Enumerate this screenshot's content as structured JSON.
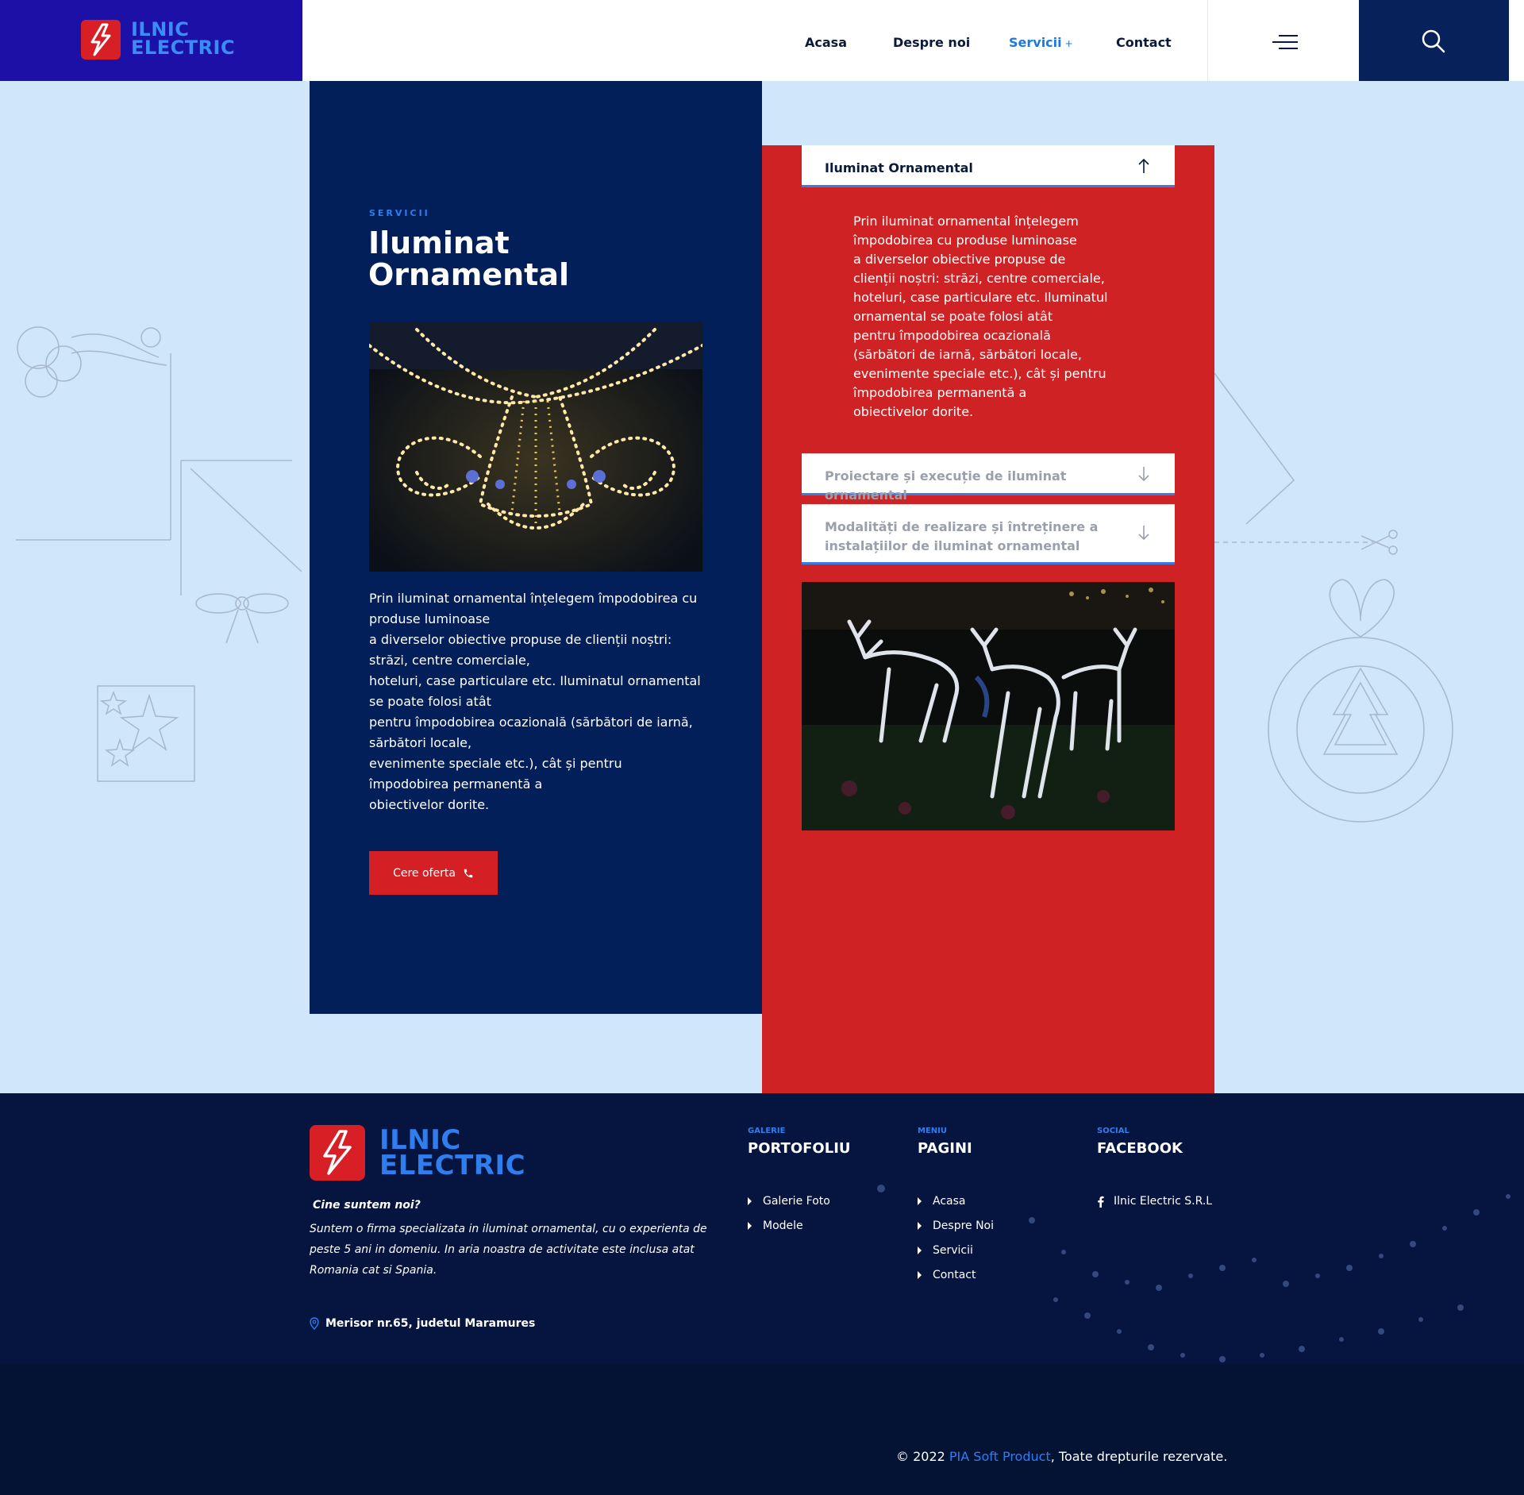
{
  "brand": {
    "line1": "ILNIC",
    "line2": "ELECTRIC"
  },
  "nav": {
    "items": [
      "Acasa",
      "Despre noi",
      "Servicii",
      "Contact"
    ],
    "active": "Servicii",
    "servicii_suffix": "+"
  },
  "colors": {
    "header_logo_bg": "#1d10a6",
    "dark_panel": "#031f5a",
    "red_panel": "#ce2225",
    "accent_blue": "#2f7ef0",
    "page_bg": "#cfe6fb",
    "footer_bg": "#05153f"
  },
  "icons": {
    "menu": "hamburger-icon",
    "search": "search-icon",
    "phone": "phone-icon",
    "facebook": "facebook-icon",
    "location": "location-pin-icon"
  },
  "hero": {
    "eyebrow": "SERVICII",
    "title": "Iluminat Ornamental",
    "description_lines": [
      "Prin iluminat ornamental înțelegem împodobirea cu",
      "produse luminoase",
      "a diverselor obiective propuse de clienții noștri:",
      "străzi, centre comerciale,",
      "hoteluri, case particulare etc. Iluminatul ornamental",
      "se poate folosi atât",
      "pentru împodobirea ocazională (sărbători de iarnă,",
      "sărbători locale,",
      "evenimente speciale etc.), cât și pentru",
      "împodobirea permanentă a",
      "obiectivelor dorite."
    ],
    "cta": "Cere oferta"
  },
  "accordion": {
    "open_title": "Iluminat Ornamental",
    "open_body_lines": [
      "Prin iluminat ornamental înțelegem",
      "împodobirea cu produse luminoase",
      "a diverselor obiective propuse de",
      "clienții noștri: străzi, centre comerciale,",
      "hoteluri, case particulare etc. Iluminatul",
      "ornamental se poate folosi atât",
      "pentru împodobirea ocazională",
      "(sărbători de iarnă, sărbători locale,",
      "evenimente speciale etc.), cât și pentru",
      "împodobirea permanentă a",
      "obiectivelor dorite."
    ],
    "item2": "Proiectare și execuție de iluminat ornamental",
    "item3": "Modalități de realizare și întreținere a instalațiilor de iluminat ornamental"
  },
  "footer": {
    "about_title": "Cine suntem noi?",
    "about_text": "Suntem o firma specializata in iluminat ornamental, cu o experienta de peste 5 ani in domeniu. In aria noastra de activitate este inclusa atat Romania cat si Spania.",
    "address": "Merisor nr.65, judetul Maramures",
    "col1": {
      "eyebrow": "GALERIE",
      "title": "PORTOFOLIU",
      "links": [
        "Galerie Foto",
        "Modele"
      ]
    },
    "col2": {
      "eyebrow": "MENIU",
      "title": "PAGINI",
      "links": [
        "Acasa",
        "Despre Noi",
        "Servicii",
        "Contact"
      ]
    },
    "col3": {
      "eyebrow": "SOCIAL",
      "title": "FACEBOOK",
      "links": [
        "Ilnic Electric S.R.L"
      ]
    },
    "copyright_prefix": "© 2022",
    "copyright_brand": "PIA Soft Product",
    "copyright_suffix": ", Toate drepturile rezervate."
  }
}
